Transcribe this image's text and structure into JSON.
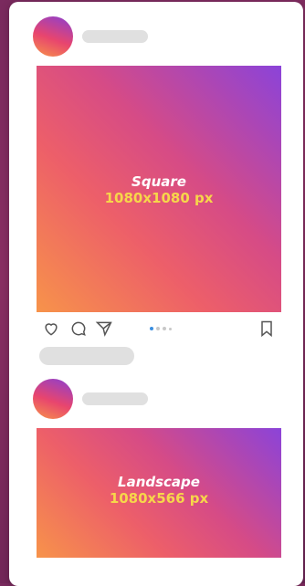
{
  "posts": [
    {
      "media": {
        "label": "Square",
        "size": "1080x1080 px"
      },
      "actions": {
        "like_icon": "heart-icon",
        "comment_icon": "comment-icon",
        "share_icon": "send-icon",
        "save_icon": "bookmark-icon"
      },
      "carousel": {
        "count": 4,
        "active": 1
      }
    },
    {
      "media": {
        "label": "Landscape",
        "size": "1080x566 px"
      }
    }
  ],
  "colors": {
    "gradient_orange": "#f7934a",
    "gradient_pink": "#ed5f69",
    "gradient_purple": "#8b43d9",
    "size_text": "#f7d64a",
    "carousel_active": "#3b8fe0"
  }
}
